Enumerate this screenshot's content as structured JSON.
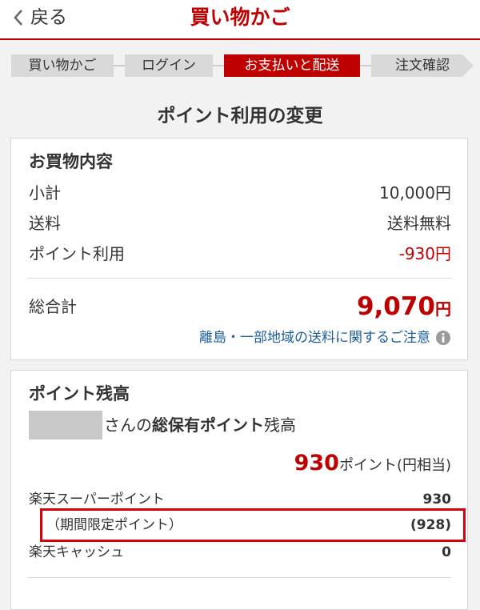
{
  "header": {
    "back_label": "戻る",
    "title": "買い物かご"
  },
  "steps": [
    {
      "label": "買い物かご",
      "active": false
    },
    {
      "label": "ログイン",
      "active": false
    },
    {
      "label": "お支払いと配送",
      "active": true
    },
    {
      "label": "注文確認",
      "active": false
    }
  ],
  "section_title": "ポイント利用の変更",
  "order_summary": {
    "heading": "お買物内容",
    "subtotal_label": "小計",
    "subtotal_value": "10,000円",
    "shipping_label": "送料",
    "shipping_value": "送料無料",
    "points_used_label": "ポイント利用",
    "points_used_value": "-930円",
    "total_label": "総合計",
    "total_value": "9,070",
    "total_unit": "円",
    "notice_link": "離島・一部地域の送料に関するご注意"
  },
  "point_balance": {
    "heading": "ポイント残高",
    "name_suffix_pre": "さんの",
    "name_suffix_bold": "総保有ポイント",
    "name_suffix_post": "残高",
    "total_points": "930",
    "total_points_unit": "ポイント(円相当)",
    "super_point_label": "楽天スーパーポイント",
    "super_point_value": "930",
    "limited_label": "（期間限定ポイント）",
    "limited_value": "(928)",
    "cash_label": "楽天キャッシュ",
    "cash_value": "0"
  },
  "colors": {
    "accent": "#bf0000",
    "link": "#1d5d9b",
    "highlight_border": "#d7000f"
  }
}
